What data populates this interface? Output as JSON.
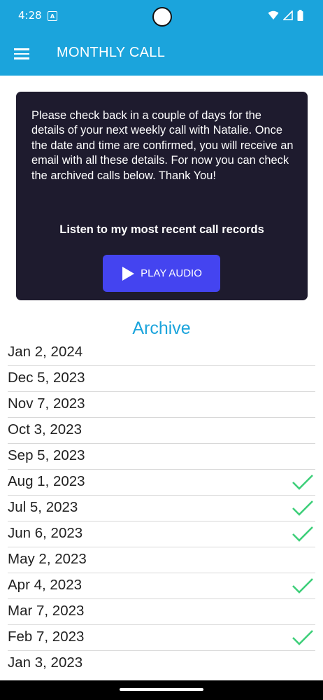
{
  "status_bar": {
    "time": "4:28",
    "notification_icon": "a-icon"
  },
  "app_bar": {
    "title": "MONTHLY CALL",
    "menu_icon": "menu-icon"
  },
  "info_card": {
    "message": "Please check back in a couple of days for the details of your next weekly call with Natalie. Once the date and time are confirmed, you will receive an email with all these details. For now you can check the archived calls below. Thank You!",
    "subtitle": "Listen to my most recent call records",
    "play_button_label": "PLAY AUDIO"
  },
  "archive": {
    "title": "Archive",
    "items": [
      {
        "date": "Jan 2, 2024",
        "completed": false
      },
      {
        "date": "Dec 5, 2023",
        "completed": false
      },
      {
        "date": "Nov 7, 2023",
        "completed": false
      },
      {
        "date": "Oct 3, 2023",
        "completed": false
      },
      {
        "date": "Sep 5, 2023",
        "completed": false
      },
      {
        "date": "Aug 1, 2023",
        "completed": true
      },
      {
        "date": "Jul 5, 2023",
        "completed": true
      },
      {
        "date": "Jun 6, 2023",
        "completed": true
      },
      {
        "date": "May 2, 2023",
        "completed": false
      },
      {
        "date": "Apr 4, 2023",
        "completed": true
      },
      {
        "date": "Mar 7, 2023",
        "completed": false
      },
      {
        "date": "Feb 7, 2023",
        "completed": true
      },
      {
        "date": "Jan 3, 2023",
        "completed": false
      }
    ]
  },
  "colors": {
    "primary": "#1ba4dc",
    "card_bg": "#1e1b2e",
    "button_bg": "#4444f0",
    "check": "#3ecf7a"
  }
}
